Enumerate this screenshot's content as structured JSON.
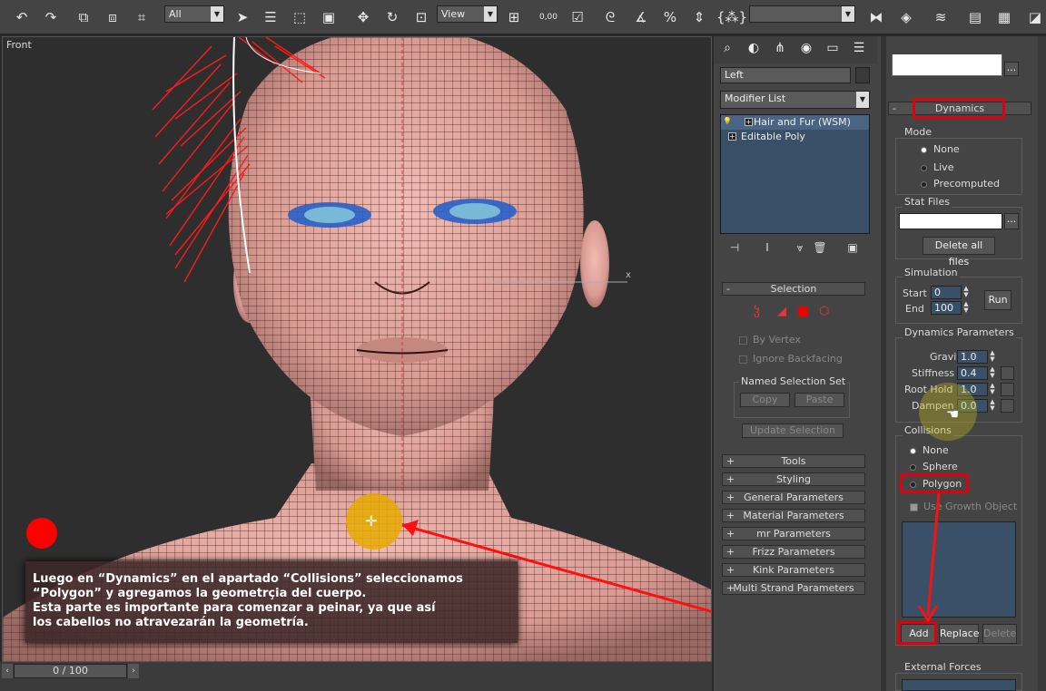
{
  "toolbar": {
    "filter_value": "All",
    "refcoord_value": "View",
    "snap_label": "0,00"
  },
  "viewport": {
    "label": "Front",
    "axis_marker": "x",
    "timeline_value": "0 / 100"
  },
  "command_panel": {
    "object_name": "Left",
    "modifier_list": "Modifier List",
    "stack_items": [
      "Hair and Fur (WSM)",
      "Editable Poly"
    ],
    "rollouts": {
      "selection": {
        "title": "Selection",
        "by_vertex": "By Vertex",
        "ignore_backfacing": "Ignore Backfacing",
        "named_selection_set": "Named Selection Set",
        "copy": "Copy",
        "paste": "Paste",
        "update_selection": "Update Selection"
      },
      "collapsed": [
        "Tools",
        "Styling",
        "General Parameters",
        "Material Parameters",
        "mr Parameters",
        "Frizz Parameters",
        "Kink Parameters",
        "Multi Strand Parameters"
      ]
    }
  },
  "dynamics": {
    "title": "Dynamics",
    "mode_label": "Mode",
    "mode_options": [
      "None",
      "Live",
      "Precomputed"
    ],
    "stat_files_label": "Stat Files",
    "browse_label": "...",
    "delete_all_files": "Delete all files",
    "simulation_label": "Simulation",
    "start_label": "Start",
    "start_value": "0",
    "end_label": "End",
    "end_value": "100",
    "run_label": "Run",
    "params_label": "Dynamics Parameters",
    "gravity_label": "Gravity",
    "gravity_value": "1.0",
    "stiffness_label": "Stiffness",
    "stiffness_value": "0.4",
    "roothold_label": "Root Hold",
    "roothold_value": "1.0",
    "dampen_label": "Dampen",
    "dampen_value": "0.0",
    "collisions_label": "Collisions",
    "collision_options": [
      "None",
      "Sphere",
      "Polygon"
    ],
    "use_growth": "Use Growth Object",
    "add_label": "Add",
    "replace_label": "Replace",
    "delete_label": "Delete",
    "external_forces": "External Forces"
  },
  "caption": {
    "lines": [
      "Luego en “Dynamics” en el apartado “Collisions” seleccionamos",
      "“Polygon” y agregamos la geometrçia del cuerpo.",
      "Esta parte es importante para comenzar a peinar, ya que así",
      "los cabellos no atravezarán la geometría."
    ]
  },
  "colors": {
    "accent": "#e00010",
    "skin": "#e8a8a0",
    "field": "#3a5068"
  }
}
